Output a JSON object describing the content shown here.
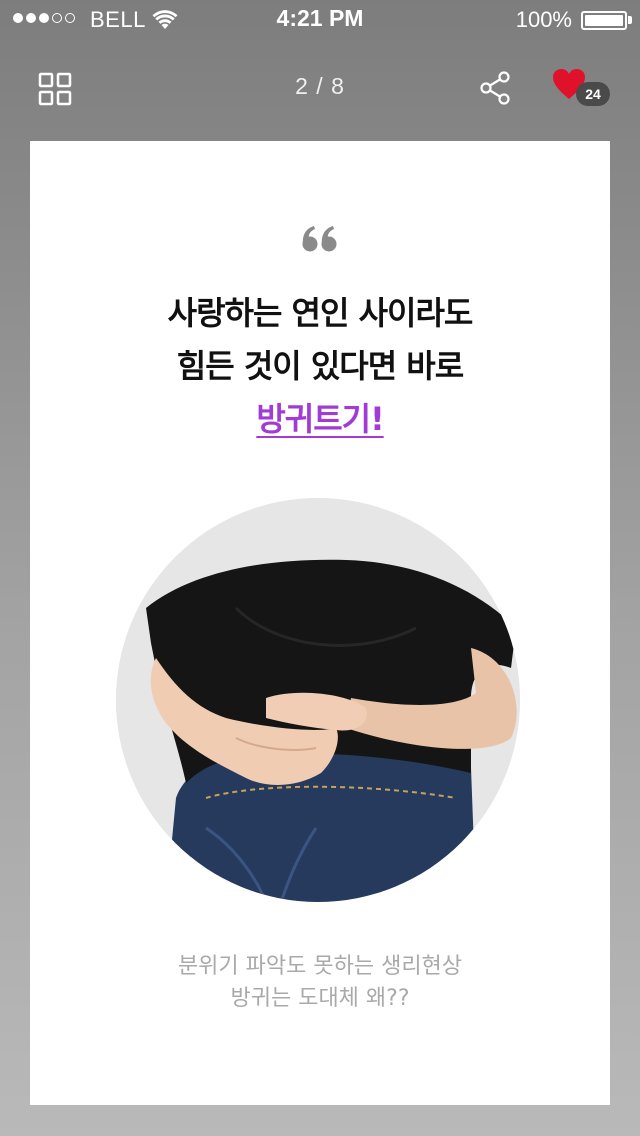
{
  "status_bar": {
    "carrier": "BELL",
    "time": "4:21 PM",
    "battery": "100%",
    "signal_bars_filled": 3,
    "signal_bars_total": 5
  },
  "nav": {
    "page_counter": "2 / 8",
    "like_count": "24",
    "icons": {
      "grid": "grid-icon",
      "share": "share-icon",
      "like": "heart-icon"
    }
  },
  "content": {
    "headline_line1": "사랑하는 연인 사이라도",
    "headline_line2": "힘든 것이 있다면 바로",
    "headline_highlight": "방귀트기!",
    "caption_line1": "분위기 파악도 못하는 생리현상",
    "caption_line2": "방귀는 도대체 왜??"
  },
  "colors": {
    "accent": "#a23bd6",
    "heart": "#e0112a",
    "caption": "#a9a9a9"
  }
}
